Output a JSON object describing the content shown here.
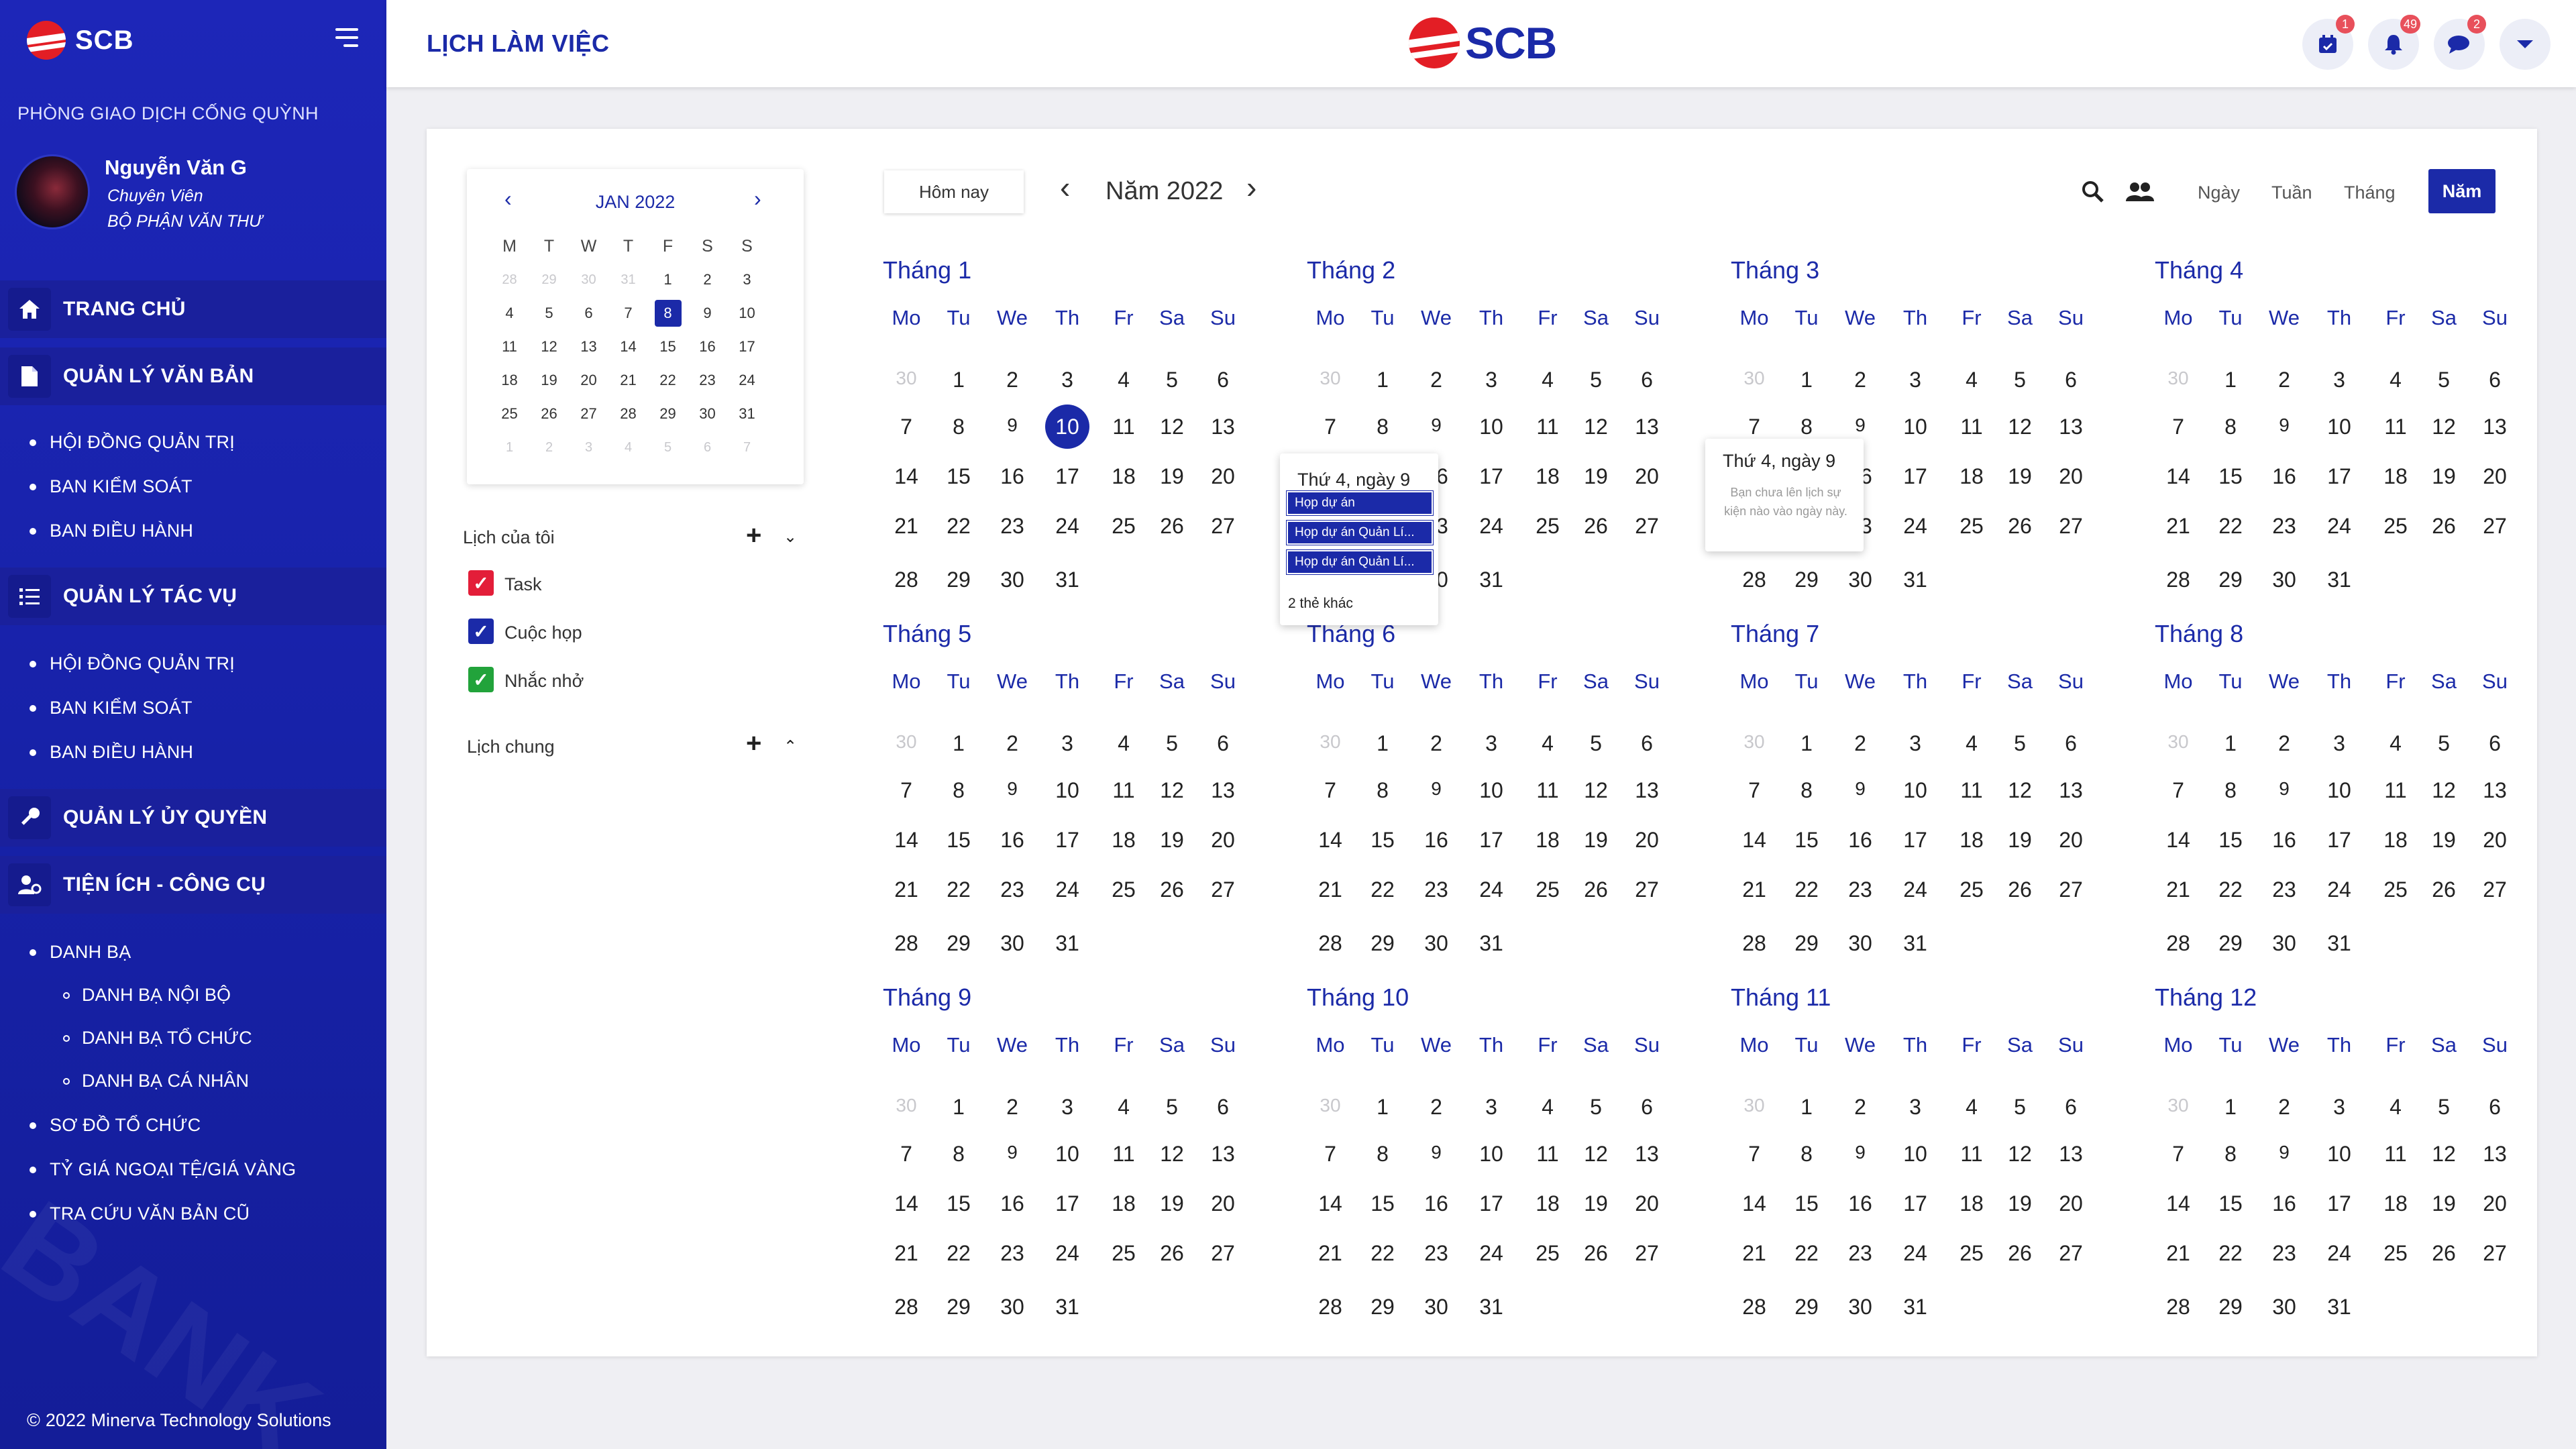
{
  "brand": {
    "name": "SCB",
    "logo_small_text": "BANK"
  },
  "sidebar": {
    "branch": "PHÒNG GIAO DỊCH CỐNG QUỲNH",
    "user": {
      "name": "Nguyễn Văn G",
      "role": "Chuyên Viên",
      "dept": "BỘ PHẬN VĂN THƯ"
    },
    "home": "TRANG CHỦ",
    "sections": [
      {
        "label": "QUẢN LÝ VĂN BẢN",
        "items": [
          "HỘI ĐỒNG QUẢN TRỊ",
          "BAN KIỂM SOÁT",
          "BAN ĐIỀU HÀNH"
        ]
      },
      {
        "label": "QUẢN LÝ TÁC VỤ",
        "items": [
          "HỘI ĐỒNG QUẢN TRỊ",
          "BAN KIỂM SOÁT",
          "BAN ĐIỀU HÀNH"
        ]
      },
      {
        "label": "QUẢN LÝ ỦY QUYỀN",
        "items": []
      },
      {
        "label": "TIỆN ÍCH - CÔNG CỤ",
        "items": [
          "DANH BẠ",
          "SƠ ĐỒ TỔ CHỨC",
          "TỶ GIÁ NGOẠI TỆ/GIÁ VÀNG",
          "TRA CỨU VĂN BẢN CŨ"
        ]
      }
    ],
    "danh_ba_sub": [
      "DANH BẠ NỘI BỘ",
      "DANH BẠ TỔ CHỨC",
      "DANH BẠ CÁ NHÂN"
    ],
    "footer": "2022 Minerva Technology Solutions",
    "watermark": "BANK"
  },
  "topbar": {
    "title": "LỊCH LÀM VIỆC",
    "badges": {
      "calendar": "1",
      "notifications": "49",
      "messages": "2"
    }
  },
  "mini_calendar": {
    "month_label": "JAN 2022",
    "weekday_headers": [
      "M",
      "T",
      "W",
      "T",
      "F",
      "S",
      "S"
    ],
    "weeks": [
      [
        "28",
        "29",
        "30",
        "31",
        "1",
        "2",
        "3"
      ],
      [
        "4",
        "5",
        "6",
        "7",
        "8",
        "9",
        "10"
      ],
      [
        "11",
        "12",
        "13",
        "14",
        "15",
        "16",
        "17"
      ],
      [
        "18",
        "19",
        "20",
        "21",
        "22",
        "23",
        "24"
      ],
      [
        "25",
        "26",
        "27",
        "28",
        "29",
        "30",
        "31"
      ],
      [
        "1",
        "2",
        "3",
        "4",
        "5",
        "6",
        "7"
      ]
    ],
    "selected": "8"
  },
  "my_calendars": {
    "title": "Lịch của tôi",
    "items": [
      {
        "label": "Task",
        "color": "#e31e39"
      },
      {
        "label": "Cuộc họp",
        "color": "#1b2aa8"
      },
      {
        "label": "Nhắc nhở",
        "color": "#22a33b"
      }
    ]
  },
  "shared_calendar": {
    "title": "Lịch chung"
  },
  "toolbar": {
    "today": "Hôm nay",
    "year_title": "Năm 2022",
    "views": [
      "Ngày",
      "Tuần",
      "Tháng"
    ],
    "active_view": "Năm"
  },
  "year_view": {
    "weekday_headers": [
      "Mo",
      "Tu",
      "We",
      "Th",
      "Fr",
      "Sa",
      "Su"
    ],
    "months": [
      "Tháng 1",
      "Tháng 2",
      "Tháng 3",
      "Tháng 4",
      "Tháng 5",
      "Tháng 6",
      "Tháng 7",
      "Tháng 8",
      "Tháng 9",
      "Tháng 10",
      "Tháng 11",
      "Tháng 12"
    ],
    "weeks": [
      [
        "30",
        "1",
        "2",
        "3",
        "4",
        "5",
        "6"
      ],
      [
        "7",
        "8",
        "9",
        "10",
        "11",
        "12",
        "13"
      ],
      [
        "14",
        "15",
        "16",
        "17",
        "18",
        "19",
        "20"
      ],
      [
        "21",
        "22",
        "23",
        "24",
        "25",
        "26",
        "27"
      ],
      [
        "28",
        "29",
        "30",
        "31"
      ]
    ],
    "today": "10"
  },
  "popover_events": {
    "title": "Thứ 4, ngày 9",
    "events": [
      "Họp dự án",
      "Họp dự án Quản Lí...",
      "Họp dự án Quản Lí..."
    ],
    "more": "2 thẻ khác"
  },
  "popover_empty": {
    "title": "Thứ 4, ngày 9",
    "message": "Bạn chưa lên lịch sự kiện nào vào ngày này."
  }
}
